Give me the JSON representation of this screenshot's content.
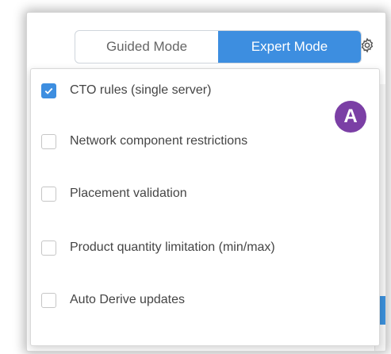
{
  "mode_toggle": {
    "guided_label": "Guided Mode",
    "expert_label": "Expert Mode",
    "active": "Expert Mode"
  },
  "settings": {
    "icon": "gear-icon"
  },
  "rules_menu": {
    "items": [
      {
        "label": "CTO rules (single server)",
        "checked": true
      },
      {
        "label": "Network component restrictions",
        "checked": false
      },
      {
        "label": "Placement validation",
        "checked": false
      },
      {
        "label": "Product quantity limitation (min/max)",
        "checked": false
      },
      {
        "label": "Auto Derive updates",
        "checked": false
      }
    ]
  },
  "callout": {
    "label": "A"
  },
  "colors": {
    "accent": "#3d8ee0",
    "callout": "#7b3fa5",
    "text": "#454545"
  }
}
